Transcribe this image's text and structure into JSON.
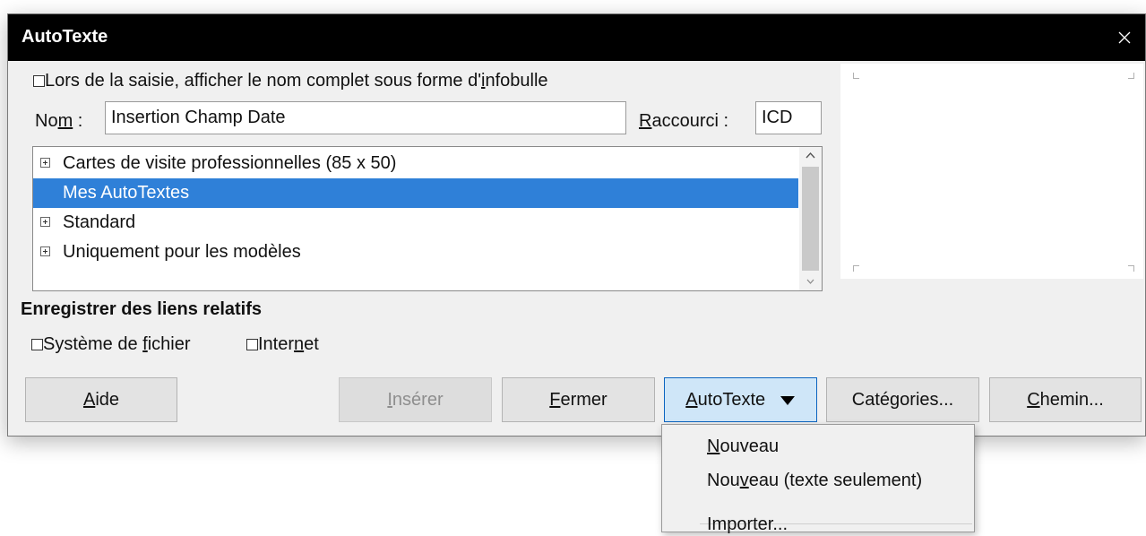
{
  "dialog": {
    "title": "AutoTexte",
    "tooltip_checkbox": {
      "before": "Lors de la saisie, afficher le nom complet sous forme d'",
      "mnemonic": "i",
      "after": "nfobulle",
      "checked": false
    },
    "name_label": {
      "before": "No",
      "mnemonic": "m",
      "after": " :"
    },
    "name_value": "Insertion Champ Date",
    "shortcut_label": {
      "before": "",
      "mnemonic": "R",
      "after": "accourci :"
    },
    "shortcut_value": "ICD",
    "tree": {
      "items": [
        {
          "label": "Cartes de visite professionnelles (85 x 50)",
          "expandable": true,
          "selected": false
        },
        {
          "label": "Mes AutoTextes",
          "expandable": false,
          "selected": true
        },
        {
          "label": "Standard",
          "expandable": true,
          "selected": false
        },
        {
          "label": "Uniquement pour les modèles",
          "expandable": true,
          "selected": false
        }
      ]
    },
    "relative_links": {
      "title": "Enregistrer des liens relatifs",
      "filesystem": {
        "before": "Système de ",
        "mnemonic": "f",
        "after": "ichier",
        "checked": false
      },
      "internet": {
        "before": "Inter",
        "mnemonic": "n",
        "after": "et",
        "checked": false
      }
    },
    "buttons": {
      "help": {
        "before": "",
        "mnemonic": "A",
        "after": "ide"
      },
      "insert": {
        "before": "",
        "mnemonic": "I",
        "after": "nsérer"
      },
      "close": {
        "before": "",
        "mnemonic": "F",
        "after": "ermer"
      },
      "autotext": {
        "before": "",
        "mnemonic": "A",
        "after": "utoTexte"
      },
      "categories": {
        "before": "Caté",
        "mnemonic": "g",
        "after": "ories..."
      },
      "path": {
        "before": "",
        "mnemonic": "C",
        "after": "hemin..."
      }
    }
  },
  "menu": {
    "items": [
      {
        "before": "",
        "mnemonic": "N",
        "after": "ouveau"
      },
      {
        "before": "Nou",
        "mnemonic": "v",
        "after": "eau (texte seulement)"
      },
      {
        "before": "Importer...",
        "mnemonic": "",
        "after": ""
      }
    ]
  },
  "colors": {
    "selection": "#2f80d8",
    "titlebar": "#000000",
    "dropdown_active": "#cfe6f8"
  }
}
